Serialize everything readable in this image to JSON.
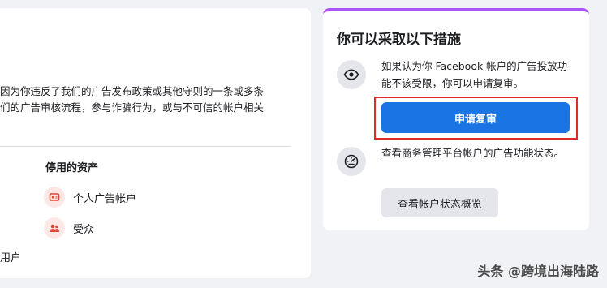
{
  "left_panel": {
    "reason_line_1": "因为你违反了我们的广告发布政策或其他守则的一条或多条",
    "reason_line_2": "们的广告审核流程，参与诈骗行为，或与不可信的帐户相关",
    "reason_line_3": "",
    "disabled_assets": {
      "heading": "停用的资产",
      "items": [
        {
          "label": "个人广告帐户",
          "icon": "ad-account-icon"
        },
        {
          "label": "受众",
          "icon": "audience-icon"
        }
      ]
    },
    "users_fragment": "用户"
  },
  "right_panel": {
    "title": "你可以采取以下措施",
    "accent_color": "#a855f7",
    "option_review": {
      "icon": "eye-icon",
      "text": "如果认为你 Facebook 帐户的广告投放功能不该受限，你可以申请复审。",
      "button_label": "申请复审",
      "button_color": "#1b74e4",
      "highlight_color": "#e02a2a"
    },
    "option_status": {
      "icon": "gauge-icon",
      "text": "查看商务管理平台帐户的广告功能状态。",
      "button_label": "查看帐户状态概览"
    }
  },
  "watermark": "头条 @跨境出海陆路"
}
